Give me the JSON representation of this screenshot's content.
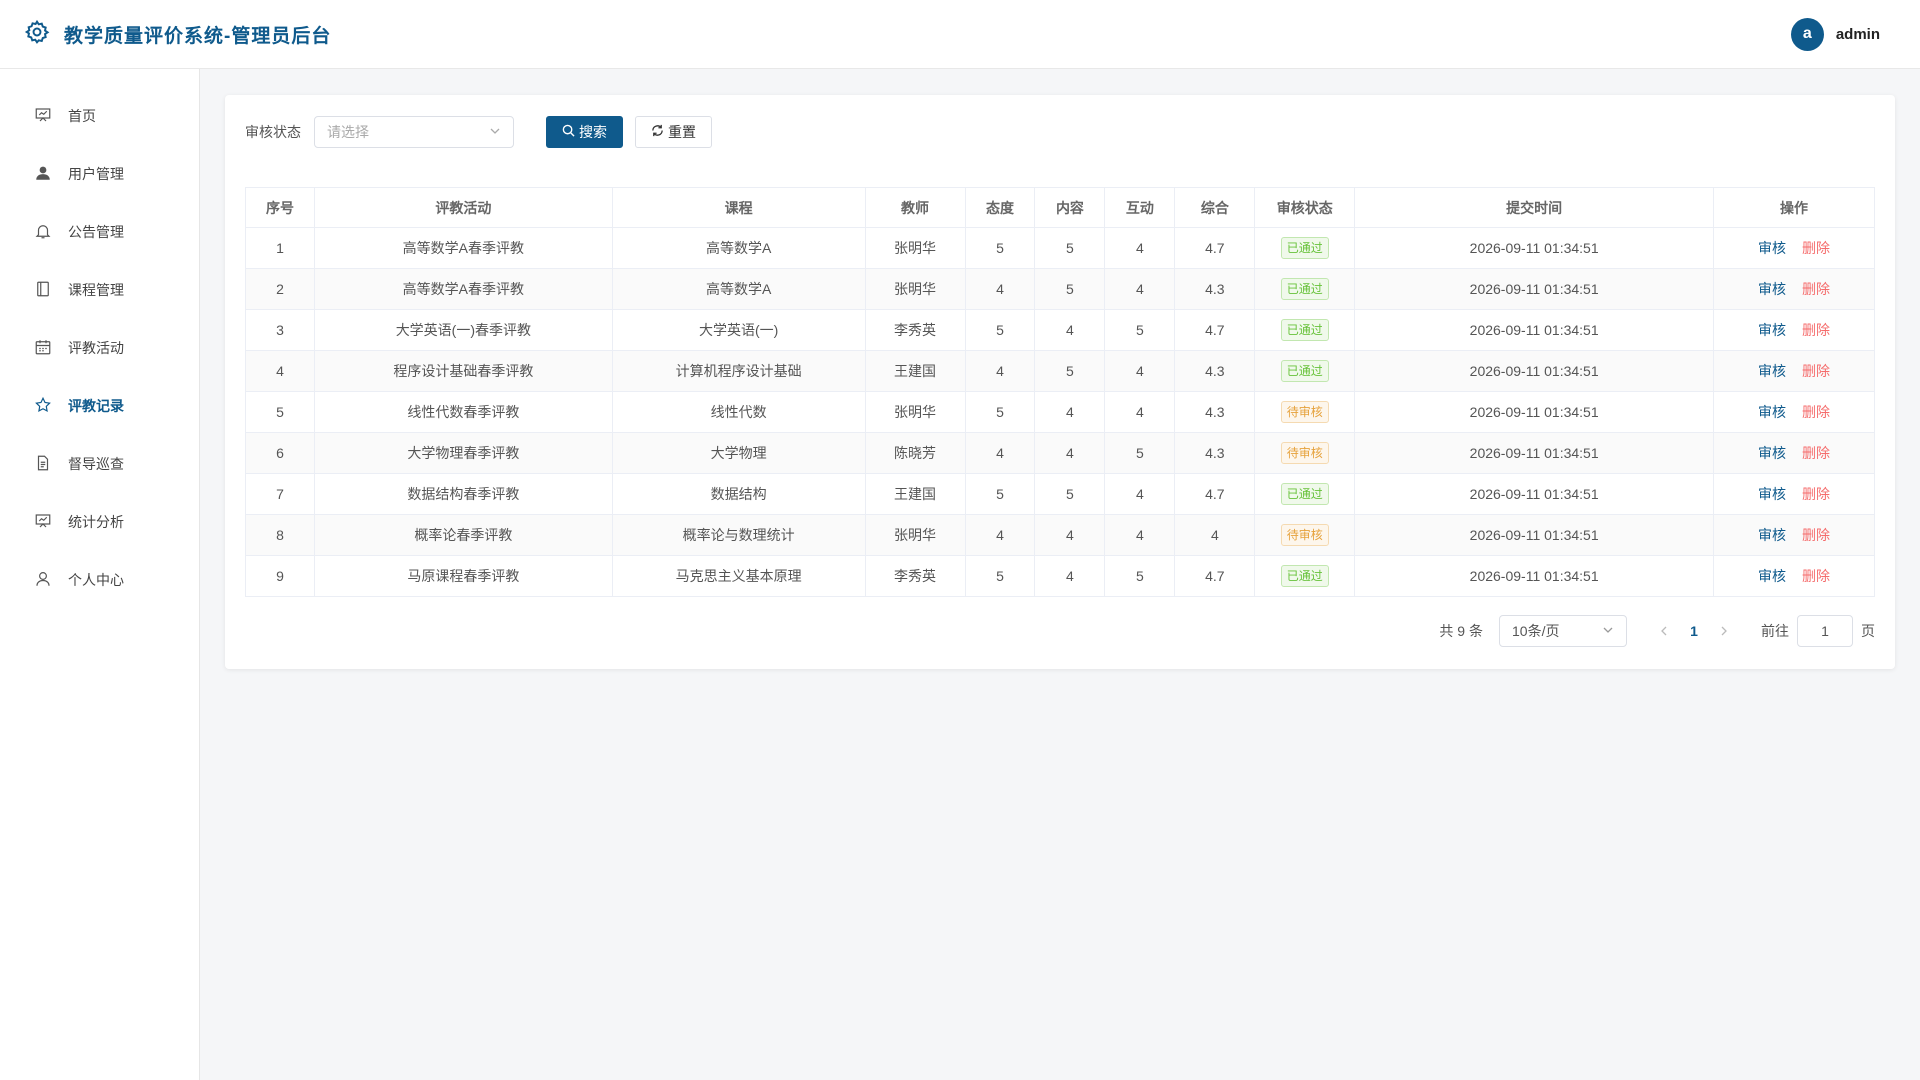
{
  "app": {
    "title": "教学质量评价系统-管理员后台"
  },
  "user": {
    "avatar_letter": "a",
    "name": "admin"
  },
  "colors": {
    "brand": "#0f5a8c",
    "danger": "#f56c6c",
    "success": "#67c23a",
    "warning": "#e6a23c"
  },
  "sidebar": {
    "items": [
      {
        "label": "首页",
        "icon": "presentation-icon"
      },
      {
        "label": "用户管理",
        "icon": "user-icon"
      },
      {
        "label": "公告管理",
        "icon": "bell-icon"
      },
      {
        "label": "课程管理",
        "icon": "book-icon"
      },
      {
        "label": "评教活动",
        "icon": "calendar-icon"
      },
      {
        "label": "评教记录",
        "icon": "star-icon",
        "active": true
      },
      {
        "label": "督导巡查",
        "icon": "document-icon"
      },
      {
        "label": "统计分析",
        "icon": "chart-icon"
      },
      {
        "label": "个人中心",
        "icon": "person-icon"
      }
    ]
  },
  "filter": {
    "label": "审核状态",
    "placeholder": "请选择",
    "search_label": "搜索",
    "reset_label": "重置"
  },
  "table": {
    "headers": [
      "序号",
      "评教活动",
      "课程",
      "教师",
      "态度",
      "内容",
      "互动",
      "综合",
      "审核状态",
      "提交时间",
      "操作"
    ],
    "audit_label": "审核",
    "delete_label": "删除",
    "rows": [
      {
        "no": "1",
        "activity": "高等数学A春季评教",
        "course": "高等数学A",
        "teacher": "张明华",
        "attitude": "5",
        "content": "5",
        "interaction": "4",
        "overall": "4.7",
        "status": "已通过",
        "status_type": "pass",
        "time": "2026-09-11 01:34:51"
      },
      {
        "no": "2",
        "activity": "高等数学A春季评教",
        "course": "高等数学A",
        "teacher": "张明华",
        "attitude": "4",
        "content": "5",
        "interaction": "4",
        "overall": "4.3",
        "status": "已通过",
        "status_type": "pass",
        "time": "2026-09-11 01:34:51"
      },
      {
        "no": "3",
        "activity": "大学英语(一)春季评教",
        "course": "大学英语(一)",
        "teacher": "李秀英",
        "attitude": "5",
        "content": "4",
        "interaction": "5",
        "overall": "4.7",
        "status": "已通过",
        "status_type": "pass",
        "time": "2026-09-11 01:34:51"
      },
      {
        "no": "4",
        "activity": "程序设计基础春季评教",
        "course": "计算机程序设计基础",
        "teacher": "王建国",
        "attitude": "4",
        "content": "5",
        "interaction": "4",
        "overall": "4.3",
        "status": "已通过",
        "status_type": "pass",
        "time": "2026-09-11 01:34:51"
      },
      {
        "no": "5",
        "activity": "线性代数春季评教",
        "course": "线性代数",
        "teacher": "张明华",
        "attitude": "5",
        "content": "4",
        "interaction": "4",
        "overall": "4.3",
        "status": "待审核",
        "status_type": "wait",
        "time": "2026-09-11 01:34:51"
      },
      {
        "no": "6",
        "activity": "大学物理春季评教",
        "course": "大学物理",
        "teacher": "陈晓芳",
        "attitude": "4",
        "content": "4",
        "interaction": "5",
        "overall": "4.3",
        "status": "待审核",
        "status_type": "wait",
        "time": "2026-09-11 01:34:51"
      },
      {
        "no": "7",
        "activity": "数据结构春季评教",
        "course": "数据结构",
        "teacher": "王建国",
        "attitude": "5",
        "content": "5",
        "interaction": "4",
        "overall": "4.7",
        "status": "已通过",
        "status_type": "pass",
        "time": "2026-09-11 01:34:51"
      },
      {
        "no": "8",
        "activity": "概率论春季评教",
        "course": "概率论与数理统计",
        "teacher": "张明华",
        "attitude": "4",
        "content": "4",
        "interaction": "4",
        "overall": "4",
        "status": "待审核",
        "status_type": "wait",
        "time": "2026-09-11 01:34:51"
      },
      {
        "no": "9",
        "activity": "马原课程春季评教",
        "course": "马克思主义基本原理",
        "teacher": "李秀英",
        "attitude": "5",
        "content": "4",
        "interaction": "5",
        "overall": "4.7",
        "status": "已通过",
        "status_type": "pass",
        "time": "2026-09-11 01:34:51"
      }
    ]
  },
  "pagination": {
    "total_text": "共 9 条",
    "page_size": "10条/页",
    "current_page": "1",
    "goto_label": "前往",
    "goto_value": "1",
    "page_suffix": "页"
  }
}
